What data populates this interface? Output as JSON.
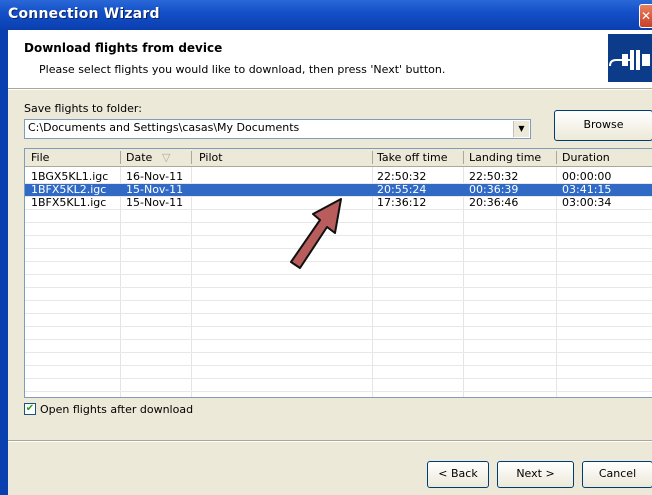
{
  "window": {
    "title": "Connection Wizard",
    "close_glyph": "✕"
  },
  "header": {
    "title": "Download flights from device",
    "subtitle": "Please select flights you would like to download, then press 'Next' button.",
    "icon": "device-connector-icon"
  },
  "folder": {
    "label": "Save flights to folder:",
    "value": "C:\\Documents and Settings\\casas\\My Documents",
    "browse_label": "Browse"
  },
  "table": {
    "columns": [
      "File",
      "Date",
      "Pilot",
      "Take off time",
      "Landing time",
      "Duration"
    ],
    "sort_indicator": "▽",
    "rows": [
      {
        "file": "1BGX5KL1.igc",
        "date": "16-Nov-11",
        "pilot": "",
        "takeoff": "22:50:32",
        "landing": "22:50:32",
        "duration": "00:00:00",
        "selected": false
      },
      {
        "file": "1BFX5KL2.igc",
        "date": "15-Nov-11",
        "pilot": "",
        "takeoff": "20:55:24",
        "landing": "00:36:39",
        "duration": "03:41:15",
        "selected": true
      },
      {
        "file": "1BFX5KL1.igc",
        "date": "15-Nov-11",
        "pilot": "",
        "takeoff": "17:36:12",
        "landing": "20:36:46",
        "duration": "03:00:34",
        "selected": false
      }
    ]
  },
  "options": {
    "open_after_download_label": "Open flights after download",
    "open_after_download_checked": true
  },
  "buttons": {
    "back": "< Back",
    "next": "Next >",
    "cancel": "Cancel"
  },
  "colors": {
    "titlebar": "#0a3fb0",
    "selection": "#316ac5",
    "annotation_arrow": "#b85c5c"
  }
}
